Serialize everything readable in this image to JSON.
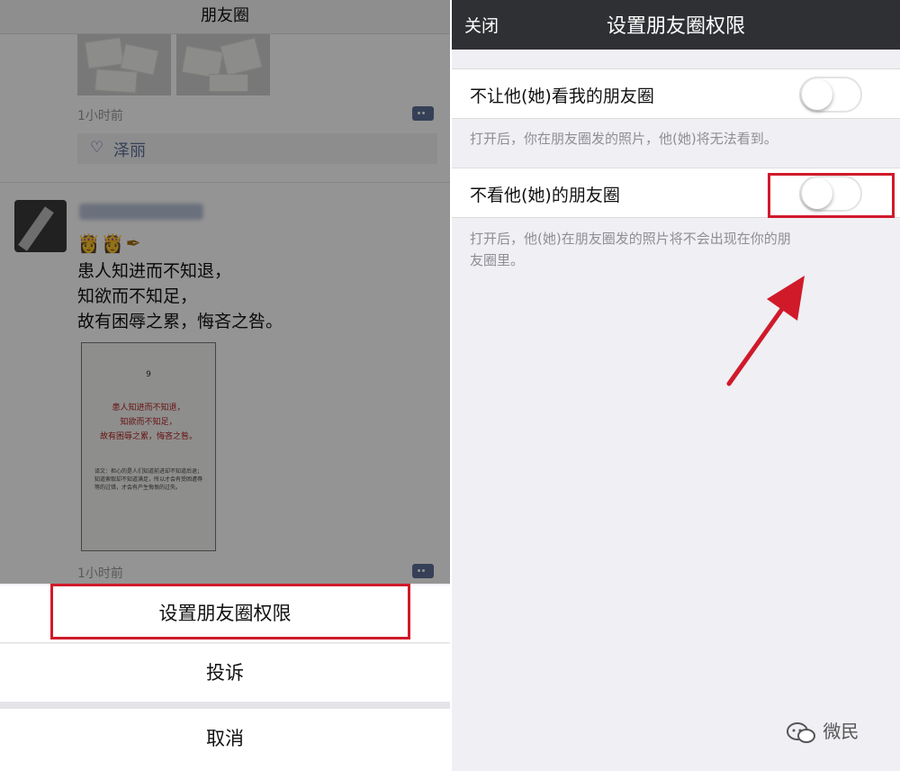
{
  "left": {
    "topbar_title": "朋友圈",
    "post1": {
      "time": "1小时前",
      "liker": "泽丽",
      "heart_icon": "♡"
    },
    "post2": {
      "emojis": "👸👸✒",
      "lines": [
        "患人知进而不知退，",
        "知欲而不知足，",
        "故有困辱之累，悔吝之咎。"
      ],
      "doc": {
        "page_number": "9",
        "quote": [
          "患人知进而不知退，",
          "知欲而不知足，",
          "故有困辱之累，悔吝之咎。"
        ],
        "translation": "译文：担心的是人们知道前进却不知道后退；知道索取却不知道满足，所以才会有受困遭辱等的过错，才会有产生悔恨的过失。"
      },
      "time": "1小时前"
    },
    "sheet": {
      "set_permission": "设置朋友圈权限",
      "report": "投诉",
      "cancel": "取消"
    }
  },
  "right": {
    "close": "关闭",
    "title": "设置朋友圈权限",
    "row1": {
      "label": "不让他(她)看我的朋友圈",
      "on": false
    },
    "hint1": "打开后，你在朋友圈发的照片，他(她)将无法看到。",
    "row2": {
      "label": "不看他(她)的朋友圈",
      "on": false
    },
    "hint2_line1": "打开后，他(她)在朋友圈发的照片将不会出现在你的朋",
    "hint2_line2": "友圈里。",
    "watermark": "微民"
  },
  "colors": {
    "highlight": "#d01a2a",
    "link_blue": "#5c6f96",
    "navbar": "#2f3034"
  }
}
